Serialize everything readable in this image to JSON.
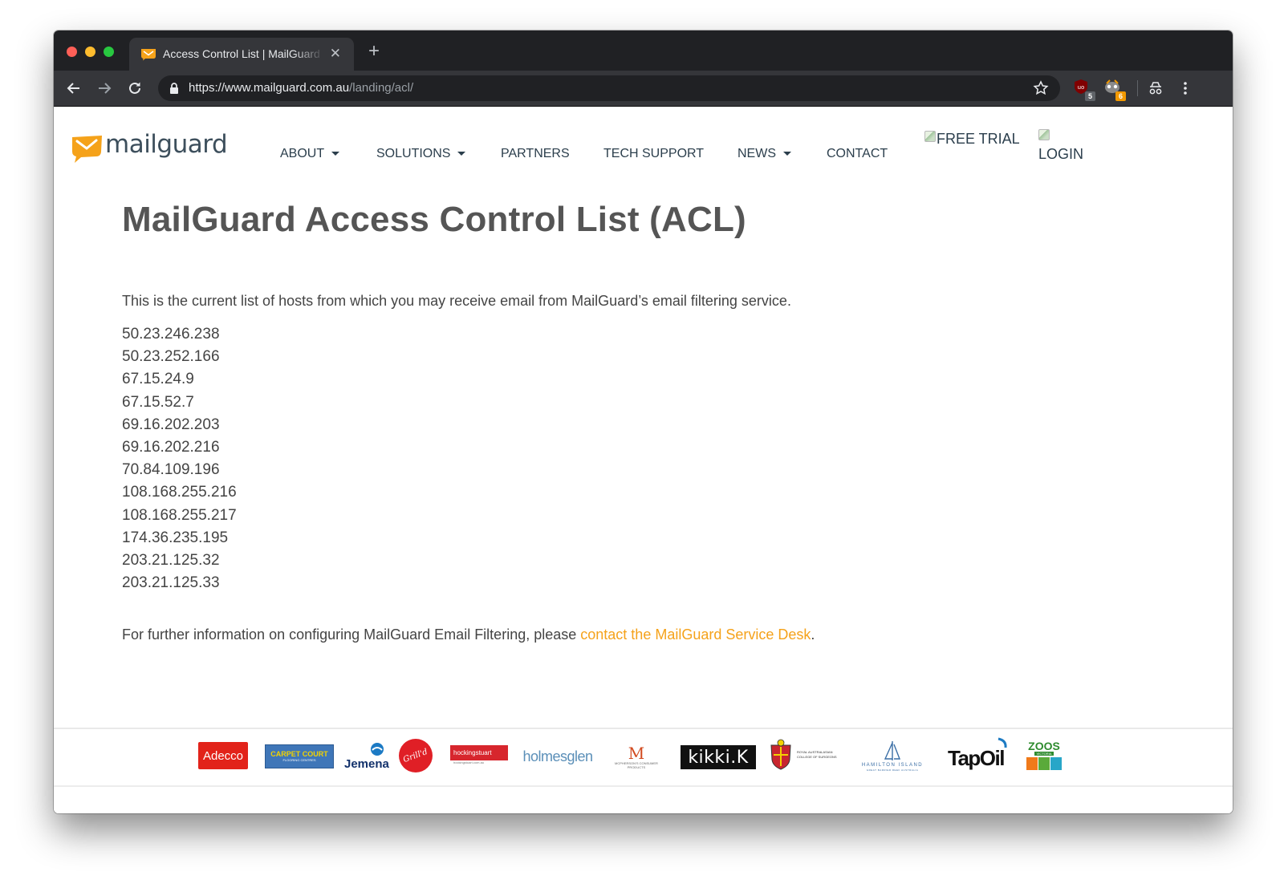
{
  "browser": {
    "tab_title": "Access Control List | MailGuard",
    "url_host": "https://www.mailguard.com.au",
    "url_path": "/landing/acl/",
    "extensions": [
      {
        "name": "ublock-origin",
        "badge": "5",
        "badge_color": "#5f6368"
      },
      {
        "name": "tampermonkey",
        "badge": "6",
        "badge_color": "#f29900"
      }
    ]
  },
  "site": {
    "logo_text": "mailguard",
    "brand_color": "#f5a21a",
    "nav": [
      {
        "label": "ABOUT",
        "has_dropdown": true
      },
      {
        "label": "SOLUTIONS",
        "has_dropdown": true
      },
      {
        "label": "PARTNERS",
        "has_dropdown": false
      },
      {
        "label": "TECH SUPPORT",
        "has_dropdown": false
      },
      {
        "label": "NEWS",
        "has_dropdown": true
      },
      {
        "label": "CONTACT",
        "has_dropdown": false
      }
    ],
    "free_trial_alt": "FREE TRIAL",
    "login_alt": "LOGIN"
  },
  "content": {
    "heading": "MailGuard Access Control List (ACL)",
    "intro": "This is the current list of hosts from which you may receive email from MailGuard’s email filtering service.",
    "ips": [
      "50.23.246.238",
      "50.23.252.166",
      "67.15.24.9",
      "67.15.52.7",
      "69.16.202.203",
      "69.16.202.216",
      "70.84.109.196",
      "108.168.255.216",
      "108.168.255.217",
      "174.36.235.195",
      "203.21.125.32",
      "203.21.125.33"
    ],
    "outro_prefix": "For further information on configuring MailGuard Email Filtering, please ",
    "outro_link": "contact the MailGuard Service Desk",
    "outro_suffix": "."
  },
  "client_logos": {
    "adecco": "Adecco",
    "carpet_court": "CARPET COURT",
    "carpet_court_sub": "FLOORING CENTRES",
    "jemena": "Jemena",
    "grilld": "Grill'd",
    "hockingstuart": "hockingstuart",
    "hockingstuart_sub": "hockingstuart.com.au",
    "holmesglen": "holmesglen",
    "mcphersons_mark": "M",
    "mcphersons_text": "MCPHERSON'S CONSUMER PRODUCTS",
    "kikki": "kikki.K",
    "racs": "ROYAL AUSTRALASIAN COLLEGE OF SURGEONS",
    "hamilton": "HAMILTON ISLAND",
    "hamilton_sub": "GREAT BARRIER REEF AUSTRALIA",
    "tapoil": "TapOil",
    "zoos": "ZOOS",
    "zoos_sub": "VICTORIA"
  }
}
